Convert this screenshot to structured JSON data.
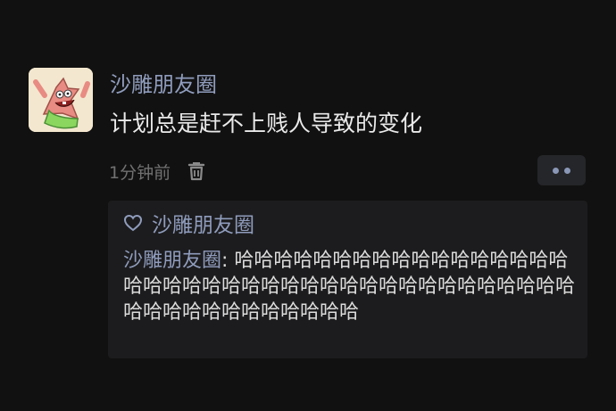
{
  "post": {
    "author": "沙雕朋友圈",
    "text": "计划总是赶不上贱人导致的变化",
    "timestamp": "1分钟前",
    "avatar_icon": "patrick-star-avatar",
    "delete_icon": "trash-icon",
    "more_icon": "more-dots-icon"
  },
  "interactions": {
    "like_icon": "heart-icon",
    "liker": "沙雕朋友圈",
    "comment": {
      "author": "沙雕朋友圈",
      "separator": ": ",
      "text": "哈哈哈哈哈哈哈哈哈哈哈哈哈哈哈哈哈哈哈哈哈哈哈哈哈哈哈哈哈哈哈哈哈哈哈哈哈哈哈哈哈哈哈哈哈哈哈哈哈哈哈哈"
    }
  },
  "colors": {
    "background": "#111111",
    "name": "#8f9cbc",
    "text": "#eaeaea",
    "muted": "#717171",
    "panel": "#1c1c1e"
  }
}
